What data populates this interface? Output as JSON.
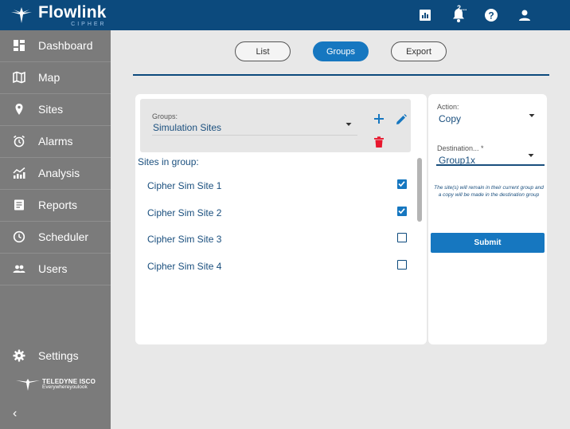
{
  "app": {
    "brand_title": "Flowlink",
    "brand_subtitle": "CIPHER",
    "notification_count": "2..."
  },
  "sidebar": {
    "items": [
      {
        "label": "Dashboard",
        "icon": "dashboard-icon"
      },
      {
        "label": "Map",
        "icon": "map-icon"
      },
      {
        "label": "Sites",
        "icon": "location-pin-icon"
      },
      {
        "label": "Alarms",
        "icon": "alarm-clock-icon"
      },
      {
        "label": "Analysis",
        "icon": "analytics-icon"
      },
      {
        "label": "Reports",
        "icon": "report-icon"
      },
      {
        "label": "Scheduler",
        "icon": "clock-icon"
      },
      {
        "label": "Users",
        "icon": "users-icon"
      }
    ],
    "settings_label": "Settings",
    "footer_brand": "TELEDYNE ISCO",
    "footer_tagline": "Everywhereyoulook",
    "collapse_glyph": "‹"
  },
  "view_tabs": {
    "list": "List",
    "groups": "Groups",
    "export": "Export",
    "active": "Groups"
  },
  "groups_panel": {
    "groups_label": "Groups:",
    "groups_value": "Simulation Sites",
    "sites_label": "Sites in group:",
    "sites": [
      {
        "name": "Cipher Sim Site 1",
        "checked": true
      },
      {
        "name": "Cipher Sim Site 2",
        "checked": true
      },
      {
        "name": "Cipher Sim Site 3",
        "checked": false
      },
      {
        "name": "Cipher Sim Site 4",
        "checked": false
      }
    ]
  },
  "action_panel": {
    "action_label": "Action:",
    "action_value": "Copy",
    "destination_label": "Destination... *",
    "destination_value": "Group1x",
    "info_text": "The site(s) will remain in their current group and a copy will be made in the destination group",
    "submit_label": "Submit"
  },
  "colors": {
    "header": "#0c4a7d",
    "accent": "#1677c0",
    "sidebar": "#7b7b7b",
    "delete": "#e8182e"
  }
}
